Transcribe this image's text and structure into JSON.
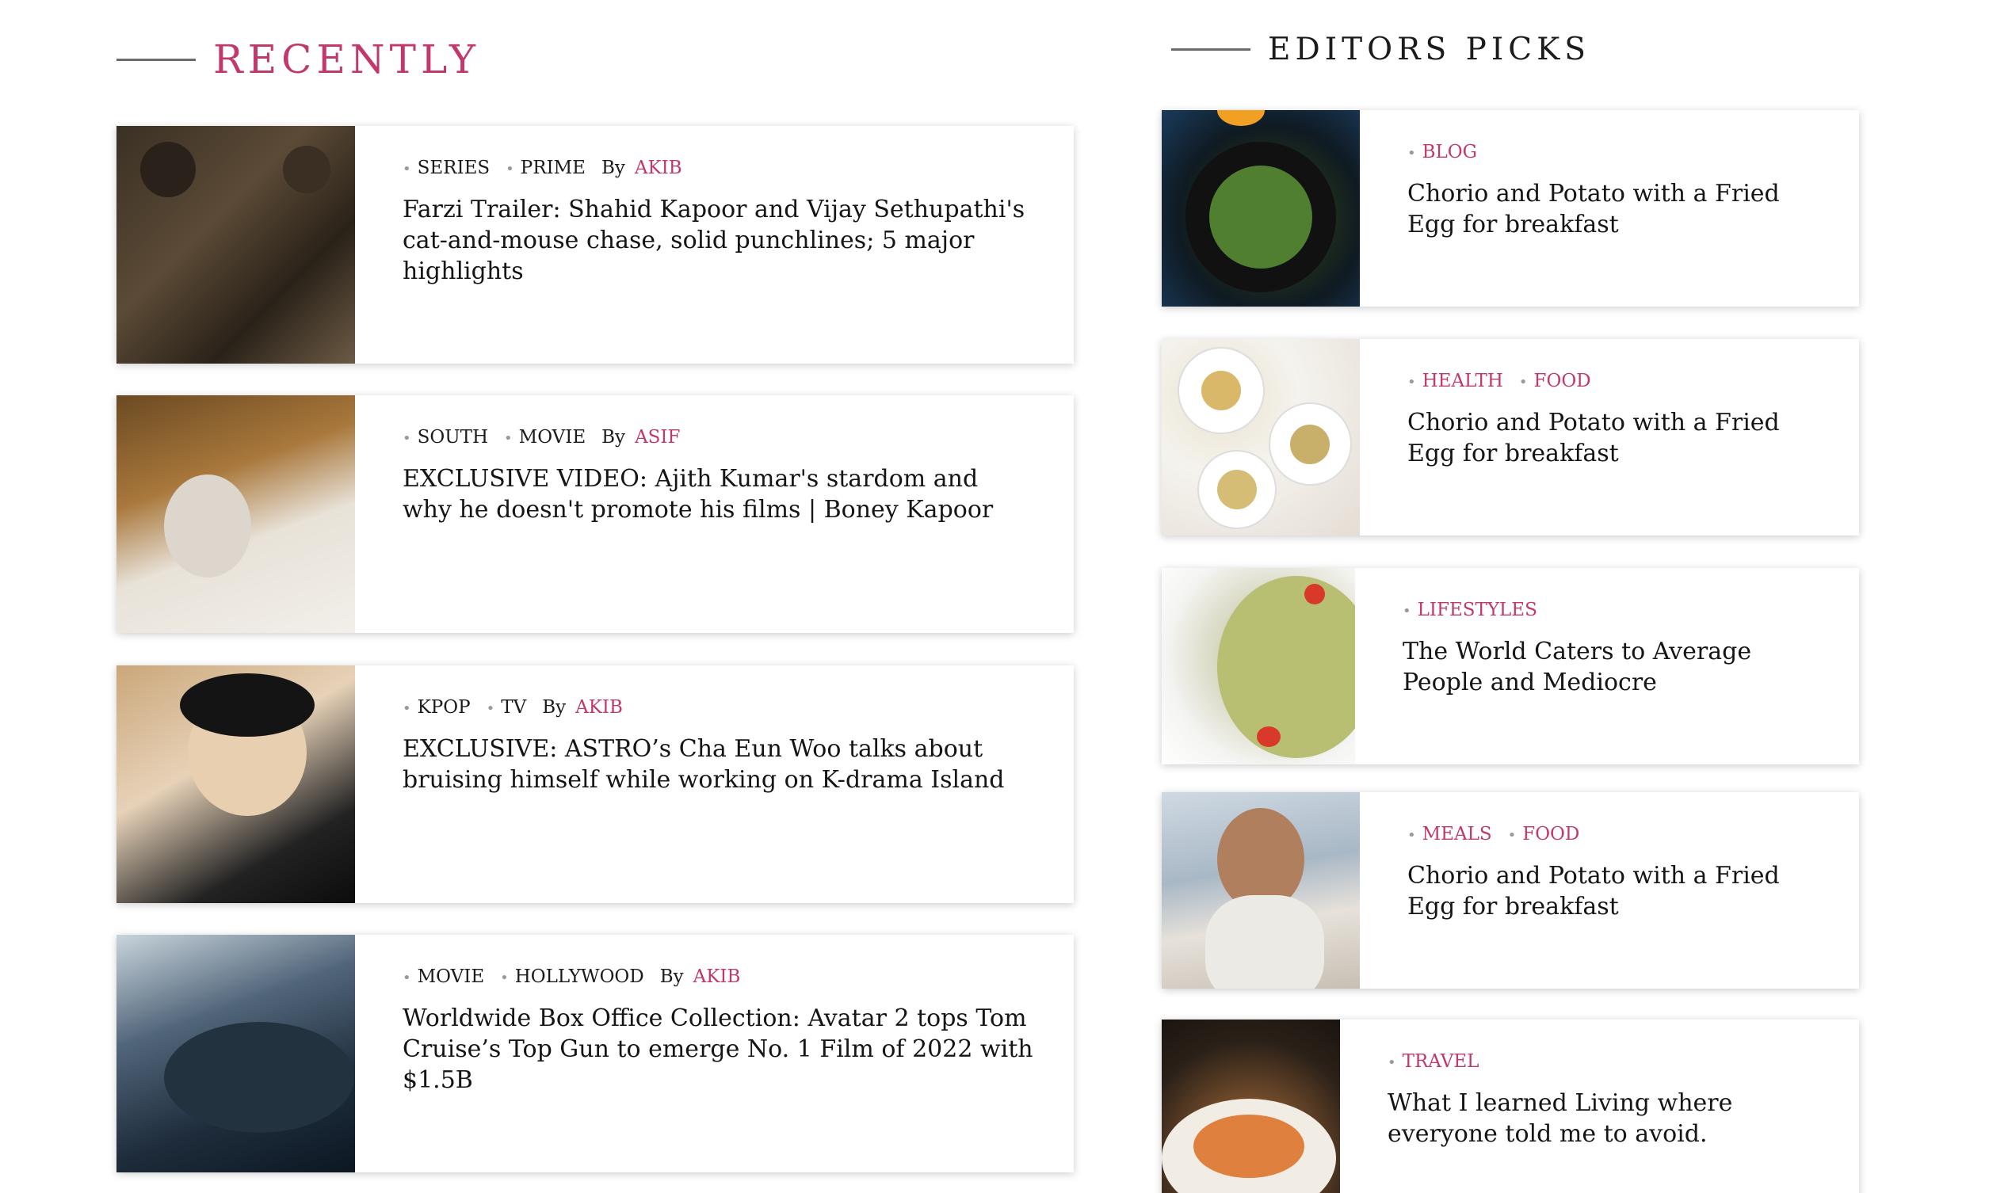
{
  "recently": {
    "heading": "RECENTLY",
    "items": [
      {
        "image": "farzi-poster",
        "categories": [
          "SERIES",
          "PRIME"
        ],
        "by": "By",
        "author": "AKIB",
        "title": "Farzi Trailer: Shahid Kapoor and Vijay Sethupathi's cat-and-mouse chase, solid punchlines; 5 major highlights"
      },
      {
        "image": "ajith-kumar-still",
        "categories": [
          "SOUTH",
          "MOVIE"
        ],
        "by": "By",
        "author": "ASIF",
        "title": "EXCLUSIVE VIDEO: Ajith Kumar's stardom and why he doesn't promote his films | Boney Kapoor"
      },
      {
        "image": "cha-eun-woo-portrait",
        "categories": [
          "KPOP",
          "TV"
        ],
        "by": "By",
        "author": "AKIB",
        "title": "EXCLUSIVE: ASTRO’s Cha Eun Woo talks about bruising himself while working on K-drama Island"
      },
      {
        "image": "avatar-2-still",
        "categories": [
          "MOVIE",
          "HOLLYWOOD"
        ],
        "by": "By",
        "author": "AKIB",
        "title": "Worldwide Box Office Collection: Avatar 2 tops Tom Cruise’s Top Gun to emerge No. 1 Film of 2022 with $1.5B"
      }
    ]
  },
  "editors_picks": {
    "heading": "EDITORS PICKS",
    "items": [
      {
        "image": "salad-bowl",
        "categories": [
          "BLOG"
        ],
        "title": "Chorio and Potato with a Fried Egg for breakfast"
      },
      {
        "image": "pasta-plates",
        "categories": [
          "HEALTH",
          "FOOD"
        ],
        "title": "Chorio and Potato with a Fried Egg for breakfast"
      },
      {
        "image": "bowtie-pasta-salad",
        "categories": [
          "LIFESTYLES"
        ],
        "title": "The World Caters to Average People and Mediocre"
      },
      {
        "image": "man-sunglasses-portrait",
        "categories": [
          "MEALS",
          "FOOD"
        ],
        "title": "Chorio and Potato with a Fried Egg for breakfast"
      },
      {
        "image": "salmon-plate",
        "categories": [
          "TRAVEL"
        ],
        "title": "What I learned Living where everyone told me to avoid."
      }
    ]
  },
  "colors": {
    "accent": "#c0386c",
    "text": "#1b1b1b",
    "rule": "#6b6b6b"
  }
}
